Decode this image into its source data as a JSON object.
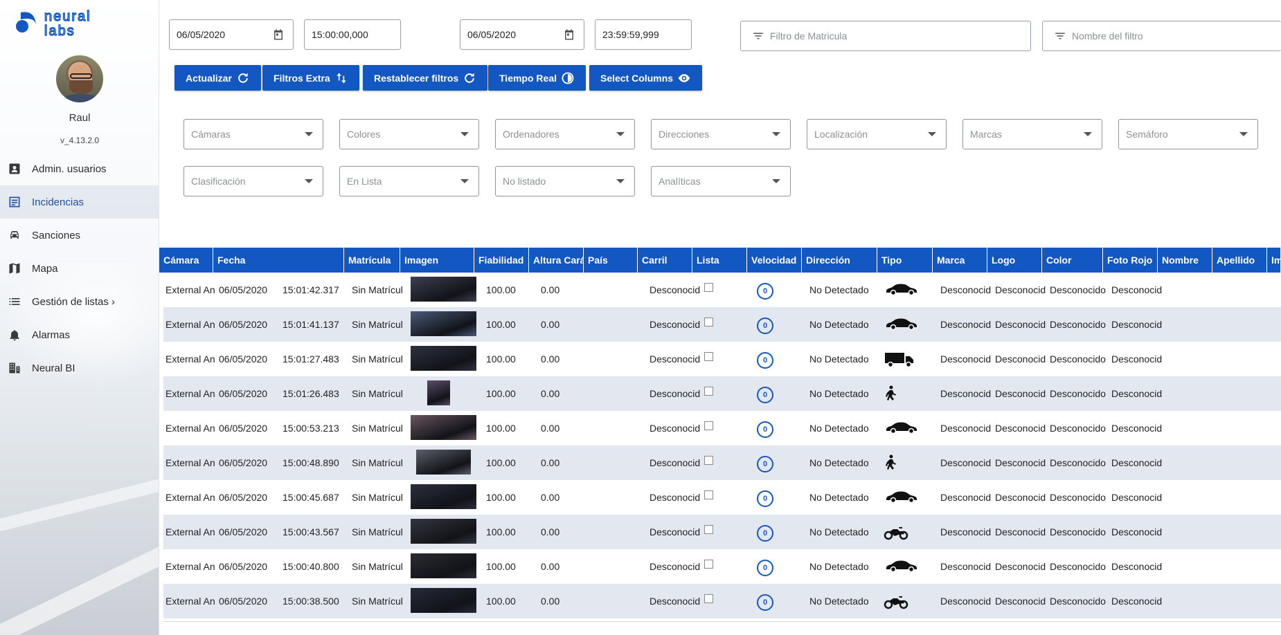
{
  "sidebar": {
    "user_name": "Raul",
    "version": "v_4.13.2.0",
    "items": [
      {
        "label": "Admin. usuarios",
        "icon": "user-badge-icon",
        "active": false
      },
      {
        "label": "Incidencias",
        "icon": "news-icon",
        "active": true
      },
      {
        "label": "Sanciones",
        "icon": "car-icon",
        "active": false
      },
      {
        "label": "Mapa",
        "icon": "map-icon",
        "active": false
      },
      {
        "label": "Gestión de listas ›",
        "icon": "list-icon",
        "active": false
      },
      {
        "label": "Alarmas",
        "icon": "bell-icon",
        "active": false
      },
      {
        "label": "Neural BI",
        "icon": "building-icon",
        "active": false
      }
    ]
  },
  "filters": {
    "date_from": "06/05/2020",
    "time_from": "15:00:00,000",
    "date_to": "06/05/2020",
    "time_to": "23:59:59,999",
    "plate_filter_placeholder": "Filtro de Matricula",
    "filter_name_placeholder": "Nombre del filtro"
  },
  "buttons": {
    "update": "Actualizar",
    "extra_filters": "Filtros Extra",
    "reset_filters": "Restablecer filtros",
    "real_time": "Tiempo Real",
    "select_columns": "Select Columns"
  },
  "selects": [
    "Cámaras",
    "Colores",
    "Ordenadores",
    "Direcciones",
    "Localización",
    "Marcas",
    "Semáforo",
    "Clasificación",
    "En Lista",
    "No listado",
    "Analíticas"
  ],
  "table": {
    "columns": [
      "Cámara",
      "Fecha",
      "Matrícula",
      "Imagen",
      "Fiabilidad",
      "Altura Cará",
      "País",
      "Carril",
      "Lista",
      "Velocidad",
      "Dirección",
      "Tipo",
      "Marca",
      "Logo",
      "Color",
      "Foto Rojo",
      "Nombre",
      "Apellido",
      "Im"
    ],
    "rows": [
      {
        "camera": "External An",
        "date": "06/05/2020",
        "time": "15:01:42.317",
        "plate": "Sin Matrícul",
        "reliability": "100.00",
        "height": "0.00",
        "lane": "Desconocid",
        "speed": "0",
        "direction": "No Detectado",
        "type": "car-icon",
        "brand": "Desconocid",
        "logo": "Desconocid",
        "color": "Desconocido",
        "red_photo": "Desconocid"
      },
      {
        "camera": "External An",
        "date": "06/05/2020",
        "time": "15:01:41.137",
        "plate": "Sin Matrícul",
        "reliability": "100.00",
        "height": "0.00",
        "lane": "Desconocid",
        "speed": "0",
        "direction": "No Detectado",
        "type": "car-icon",
        "brand": "Desconocid",
        "logo": "Desconocid",
        "color": "Desconocido",
        "red_photo": "Desconocid"
      },
      {
        "camera": "External An",
        "date": "06/05/2020",
        "time": "15:01:27.483",
        "plate": "Sin Matrícul",
        "reliability": "100.00",
        "height": "0.00",
        "lane": "Desconocid",
        "speed": "0",
        "direction": "No Detectado",
        "type": "truck-icon",
        "brand": "Desconocid",
        "logo": "Desconocid",
        "color": "Desconocido",
        "red_photo": "Desconocid"
      },
      {
        "camera": "External An",
        "date": "06/05/2020",
        "time": "15:01:26.483",
        "plate": "Sin Matrícul",
        "reliability": "100.00",
        "height": "0.00",
        "lane": "Desconocid",
        "speed": "0",
        "direction": "No Detectado",
        "type": "pedestrian-icon",
        "brand": "Desconocid",
        "logo": "Desconocid",
        "color": "Desconocido",
        "red_photo": "Desconocid"
      },
      {
        "camera": "External An",
        "date": "06/05/2020",
        "time": "15:00:53.213",
        "plate": "Sin Matrícul",
        "reliability": "100.00",
        "height": "0.00",
        "lane": "Desconocid",
        "speed": "0",
        "direction": "No Detectado",
        "type": "car-icon",
        "brand": "Desconocid",
        "logo": "Desconocid",
        "color": "Desconocido",
        "red_photo": "Desconocid"
      },
      {
        "camera": "External An",
        "date": "06/05/2020",
        "time": "15:00:48.890",
        "plate": "Sin Matrícul",
        "reliability": "100.00",
        "height": "0.00",
        "lane": "Desconocid",
        "speed": "0",
        "direction": "No Detectado",
        "type": "pedestrian-icon",
        "brand": "Desconocid",
        "logo": "Desconocid",
        "color": "Desconocido",
        "red_photo": "Desconocid"
      },
      {
        "camera": "External An",
        "date": "06/05/2020",
        "time": "15:00:45.687",
        "plate": "Sin Matrícul",
        "reliability": "100.00",
        "height": "0.00",
        "lane": "Desconocid",
        "speed": "0",
        "direction": "No Detectado",
        "type": "car-icon",
        "brand": "Desconocid",
        "logo": "Desconocid",
        "color": "Desconocido",
        "red_photo": "Desconocid"
      },
      {
        "camera": "External An",
        "date": "06/05/2020",
        "time": "15:00:43.567",
        "plate": "Sin Matrícul",
        "reliability": "100.00",
        "height": "0.00",
        "lane": "Desconocid",
        "speed": "0",
        "direction": "No Detectado",
        "type": "motorcycle-icon",
        "brand": "Desconocid",
        "logo": "Desconocid",
        "color": "Desconocido",
        "red_photo": "Desconocid"
      },
      {
        "camera": "External An",
        "date": "06/05/2020",
        "time": "15:00:40.800",
        "plate": "Sin Matrícul",
        "reliability": "100.00",
        "height": "0.00",
        "lane": "Desconocid",
        "speed": "0",
        "direction": "No Detectado",
        "type": "car-icon",
        "brand": "Desconocid",
        "logo": "Desconocid",
        "color": "Desconocido",
        "red_photo": "Desconocid"
      },
      {
        "camera": "External An",
        "date": "06/05/2020",
        "time": "15:00:38.500",
        "plate": "Sin Matrícul",
        "reliability": "100.00",
        "height": "0.00",
        "lane": "Desconocid",
        "speed": "0",
        "direction": "No Detectado",
        "type": "motorcycle-icon",
        "brand": "Desconocid",
        "logo": "Desconocid",
        "color": "Desconocido",
        "red_photo": "Desconocid"
      }
    ]
  },
  "colors": {
    "accent": "#1357c3",
    "row_alt": "#e3e7ef"
  }
}
